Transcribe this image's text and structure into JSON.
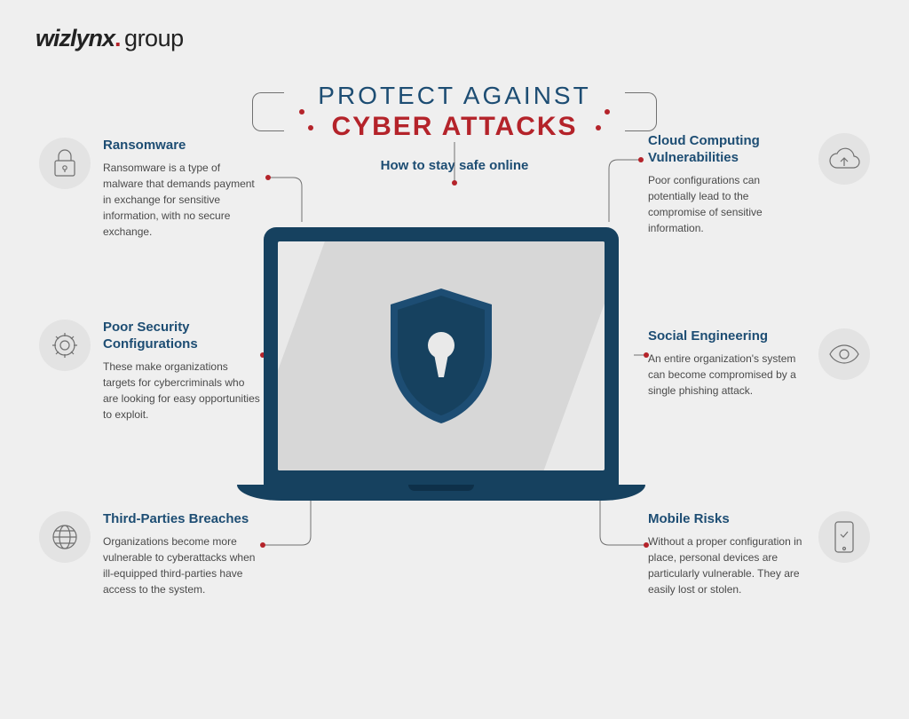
{
  "logo": {
    "brand": "wizlynx",
    "suffix": "group"
  },
  "title": {
    "line1": "PROTECT AGAINST",
    "line2": "CYBER ATTACKS"
  },
  "subtitle": "How to stay safe online",
  "items": {
    "ransomware": {
      "heading": "Ransomware",
      "desc": "Ransomware is a type of malware that demands payment in exchange for sensitive information, with no secure exchange.",
      "icon": "lock-icon"
    },
    "poor_security": {
      "heading": "Poor Security Configurations",
      "desc": "These make organizations targets for cybercriminals who are looking for easy opportunities to exploit.",
      "icon": "gear-icon"
    },
    "third_parties": {
      "heading": "Third-Parties Breaches",
      "desc": "Organizations become more vulnerable to cyberattacks when ill-equipped third-parties have access to the system.",
      "icon": "globe-icon"
    },
    "cloud": {
      "heading": "Cloud Computing Vulnerabilities",
      "desc": "Poor configurations can potentially lead to the compromise of sensitive information.",
      "icon": "cloud-icon"
    },
    "social_eng": {
      "heading": "Social Engineering",
      "desc": "An entire organization's system can become compromised by a single phishing attack.",
      "icon": "eye-icon"
    },
    "mobile": {
      "heading": "Mobile Risks",
      "desc": "Without a proper configuration in place, personal devices are particularly vulnerable. They are easily lost or stolen.",
      "icon": "phone-icon"
    }
  },
  "colors": {
    "navy": "#16415f",
    "accent_red": "#b4232a",
    "heading_blue": "#1d4d73"
  }
}
